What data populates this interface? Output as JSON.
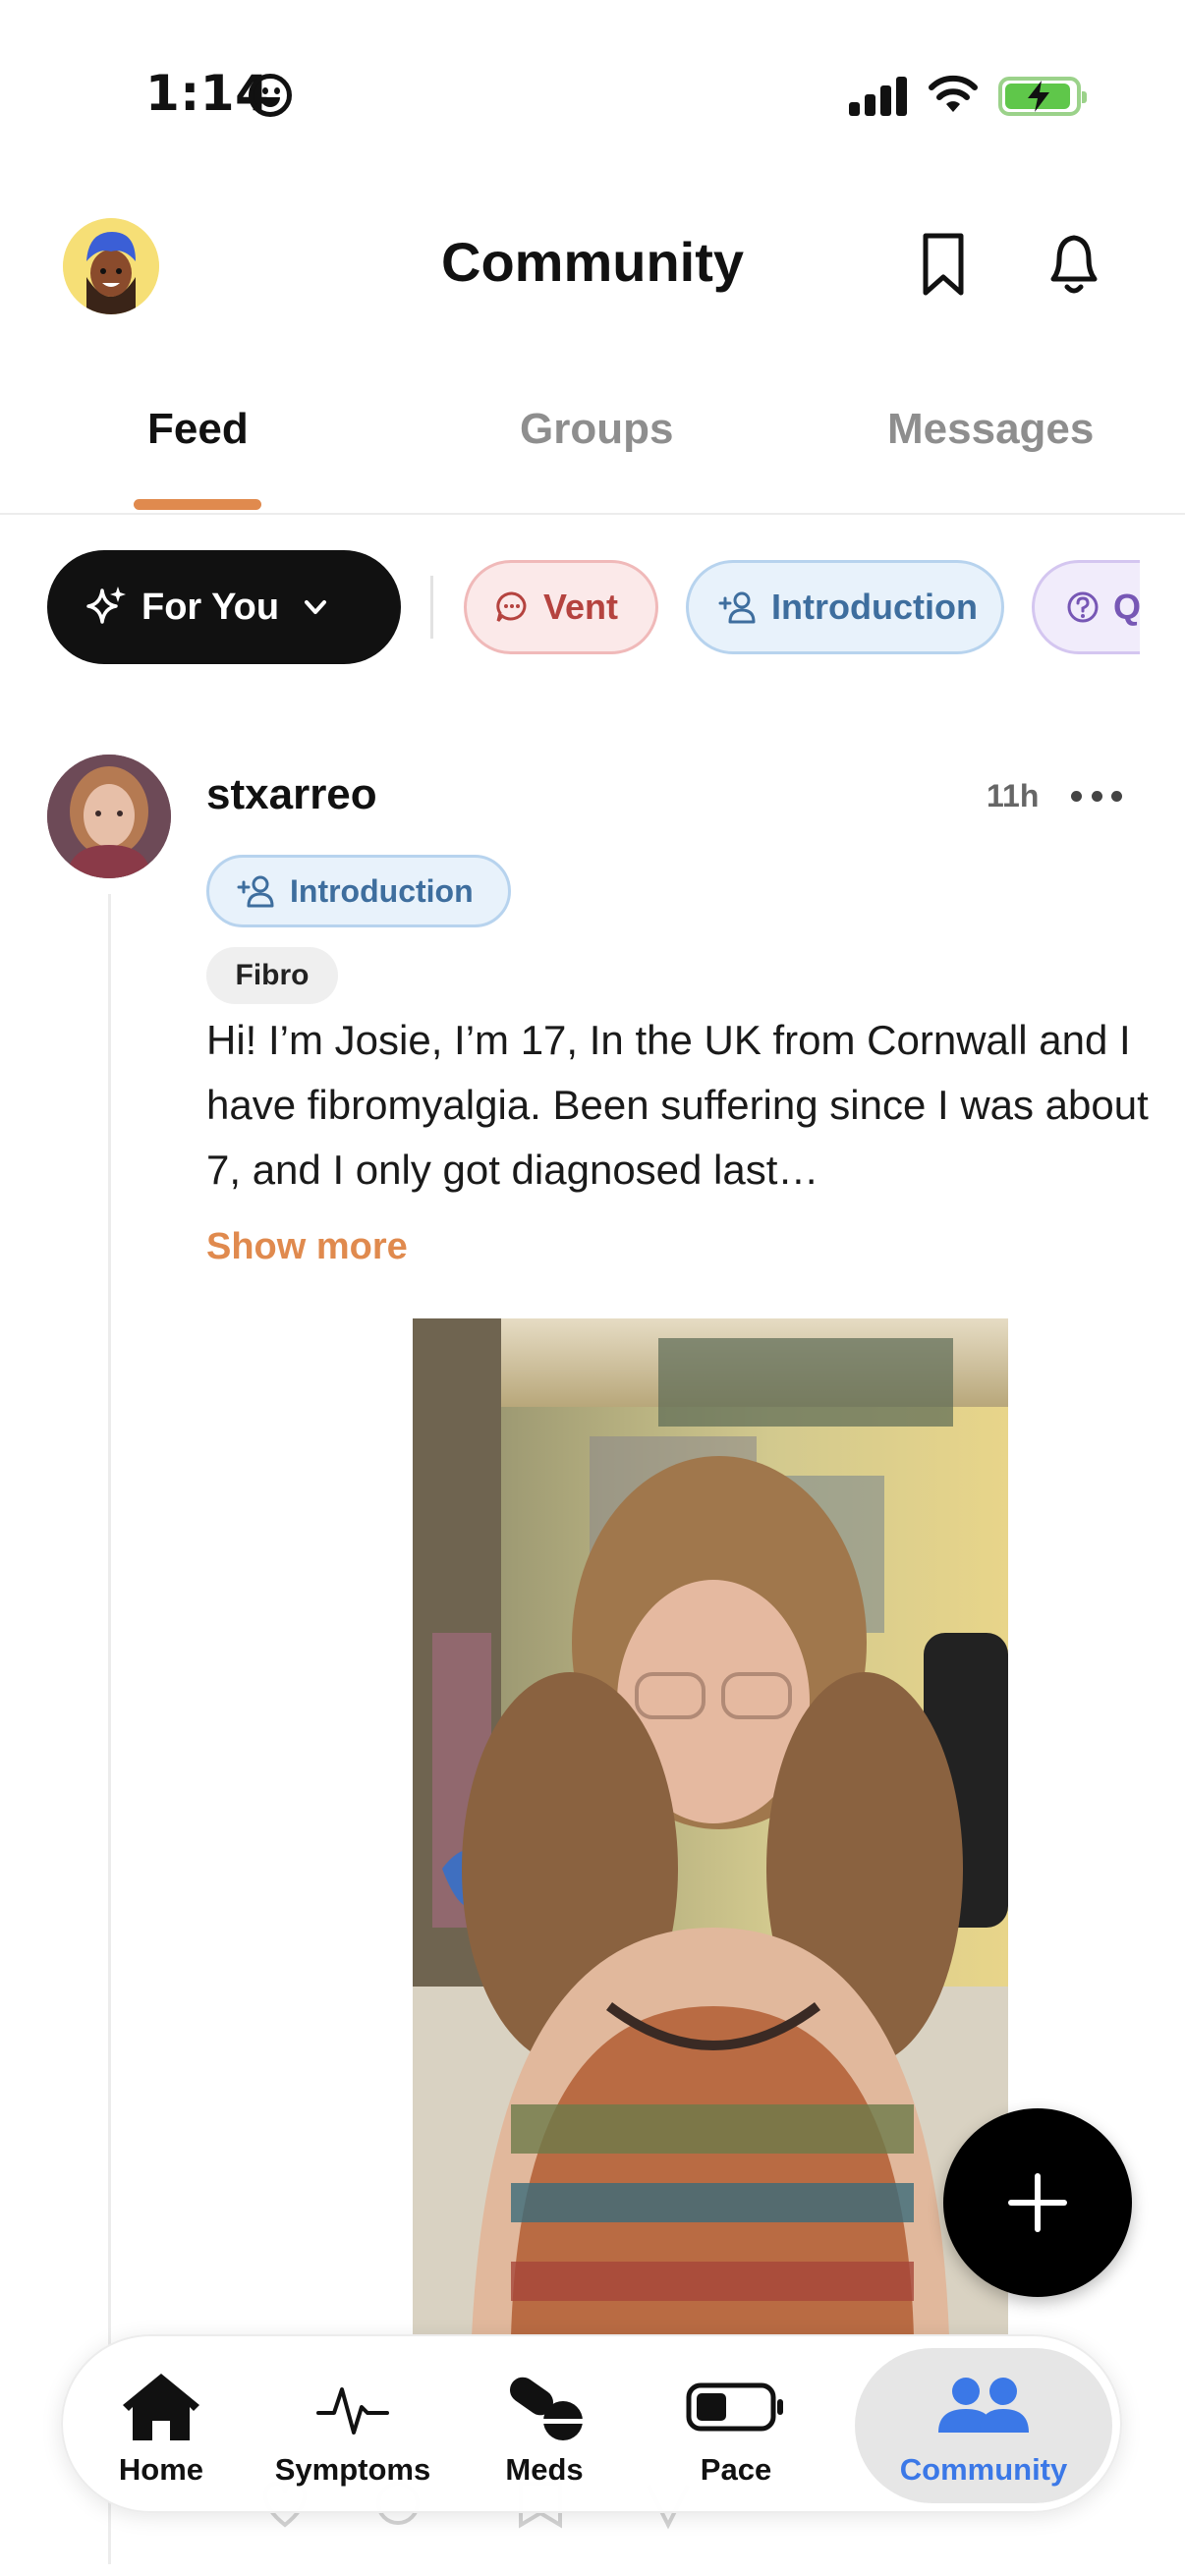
{
  "status_bar": {
    "time": "1:14"
  },
  "header": {
    "title": "Community"
  },
  "tabs": [
    {
      "label": "Feed",
      "active": true
    },
    {
      "label": "Groups",
      "active": false
    },
    {
      "label": "Messages",
      "active": false
    }
  ],
  "filters": {
    "for_you": "For You",
    "chips": [
      {
        "label": "Vent",
        "color": "#b5433f"
      },
      {
        "label": "Introduction",
        "color": "#3e6e9e"
      },
      {
        "label": "Q",
        "color": "#7757b5"
      }
    ]
  },
  "post": {
    "username": "stxarreo",
    "time": "11h",
    "badge": "Introduction",
    "tag": "Fibro",
    "text": "Hi! I’m Josie, I’m 17, In the UK from Cornwall and I have fibromyalgia. Been suffering since I was about 7, and I only got diagnosed last…",
    "show_more": "Show more"
  },
  "bottom_nav": [
    {
      "label": "Home",
      "icon": "home-icon",
      "active": false
    },
    {
      "label": "Symptoms",
      "icon": "heartbeat-icon",
      "active": false
    },
    {
      "label": "Meds",
      "icon": "pills-icon",
      "active": false
    },
    {
      "label": "Pace",
      "icon": "battery-icon",
      "active": false
    },
    {
      "label": "Community",
      "icon": "people-icon",
      "active": true
    }
  ],
  "colors": {
    "accent": "#e08a4e",
    "active_nav": "#3b78e7"
  }
}
